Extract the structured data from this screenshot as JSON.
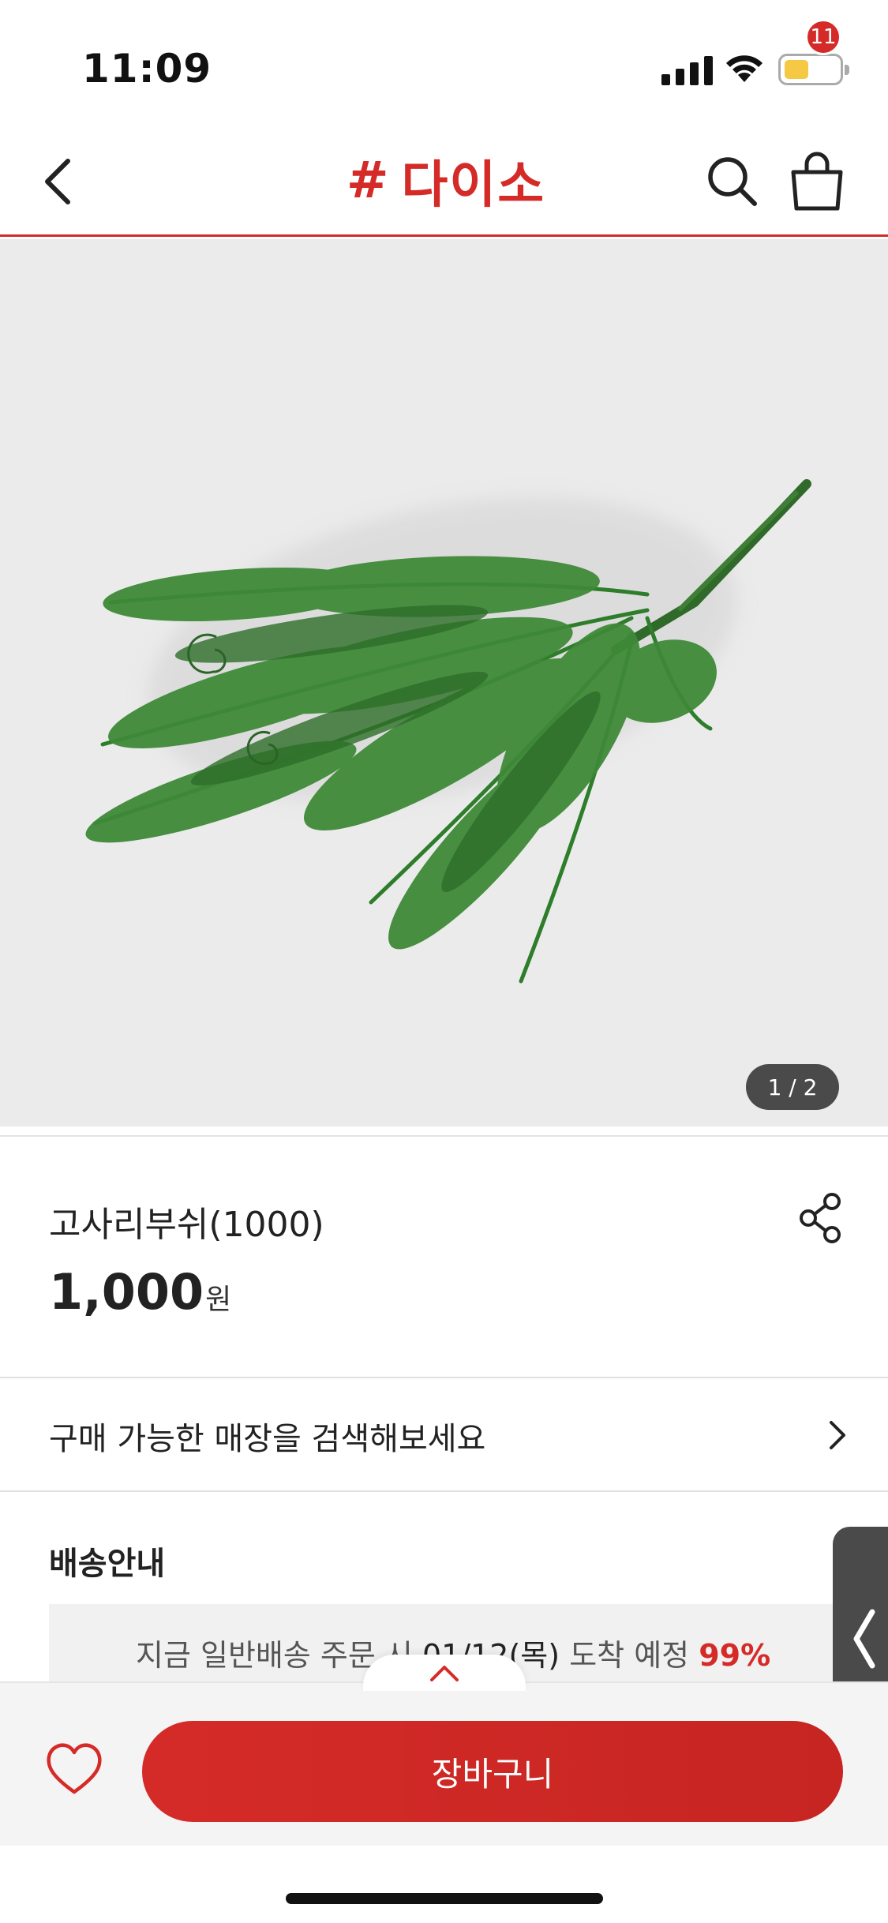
{
  "status_bar": {
    "time": "11:09"
  },
  "header": {
    "logo_text": "다이소",
    "logo_symbol": "#",
    "cart_count": "11",
    "brand_color": "#d52b28",
    "icons": [
      "chevron-left-icon",
      "search-icon",
      "shopping-bag-icon"
    ]
  },
  "gallery": {
    "counter": "1 / 2",
    "image_subject": "artificial fern bush"
  },
  "product": {
    "name": "고사리부쉬(1000)",
    "price": "1,000",
    "price_unit": "원"
  },
  "store_search": {
    "label": "구매 가능한 매장을 검색해보세요"
  },
  "shipping": {
    "title": "배송안내",
    "message_prefix": "지금 일반배송 주문 시 ",
    "message_date": "01/12",
    "message_day": "(목)",
    "message_suffix": " 도착 예정 ",
    "message_pct": "99%"
  },
  "bottom_bar": {
    "add_to_cart_label": "장바구니"
  }
}
